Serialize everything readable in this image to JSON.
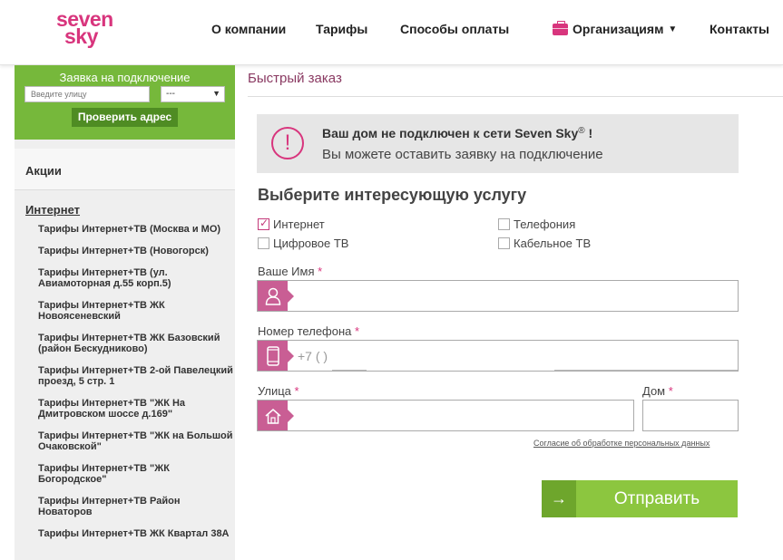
{
  "header": {
    "logo_line1": "seven",
    "logo_line2": "sky",
    "nav": {
      "about": "О компании",
      "tariffs": "Тарифы",
      "payment": "Способы оплаты",
      "organizations": "Организациям",
      "contacts": "Контакты"
    }
  },
  "sidebar": {
    "request": {
      "title": "Заявка на подключение",
      "street_placeholder": "Введите улицу",
      "house_select_value": "---",
      "check_button": "Проверить адрес"
    },
    "promo": "Акции",
    "internet_title": "Интернет",
    "tariffs": [
      "Тарифы Интернет+ТВ (Москва и МО)",
      "Тарифы Интернет+ТВ (Новогорск)",
      "Тарифы Интернет+ТВ (ул. Авиамоторная д.55 корп.5)",
      "Тарифы Интернет+ТВ ЖК Новоясеневский",
      "Тарифы Интернет+ТВ ЖК Базовский (район Бескудниково)",
      "Тарифы Интернет+ТВ 2-ой Павелецкий проезд, 5 стр. 1",
      "Тарифы Интернет+ТВ \"ЖК На Дмитровском шоссе д.169\"",
      "Тарифы Интернет+ТВ \"ЖК на Большой Очаковской\"",
      "Тарифы Интернет+ТВ \"ЖК Богородское\"",
      "Тарифы Интернет+ТВ Район Новаторов",
      "Тарифы Интернет+ТВ ЖК Квартал 38А"
    ]
  },
  "main": {
    "title": "Быстрый заказ",
    "notice": {
      "title": "Ваш дом не подключен к сети Seven Sky",
      "title_mark": "®",
      "title_end": " !",
      "text": "Вы можете оставить заявку на подключение"
    },
    "choose_title": "Выберите интересующую услугу",
    "services": {
      "internet": "Интернет",
      "telephony": "Телефония",
      "digital_tv": "Цифровое ТВ",
      "cable_tv": "Кабельное ТВ"
    },
    "service_checked": {
      "internet": true,
      "telephony": false,
      "digital_tv": false,
      "cable_tv": false
    },
    "fields": {
      "name_label": "Ваше Имя",
      "phone_label": "Номер телефона",
      "phone_prefix": "+7 (      )",
      "street_label": "Улица",
      "house_label": "Дом",
      "required_mark": "*"
    },
    "consent": "Согласие об обработке персональных данных",
    "submit": "Отправить",
    "submit_arrow": "→"
  },
  "colors": {
    "brand_pink": "#d8357d",
    "icon_pink": "#c95e94",
    "green": "#76b83b",
    "submit_green": "#8cc63f"
  }
}
